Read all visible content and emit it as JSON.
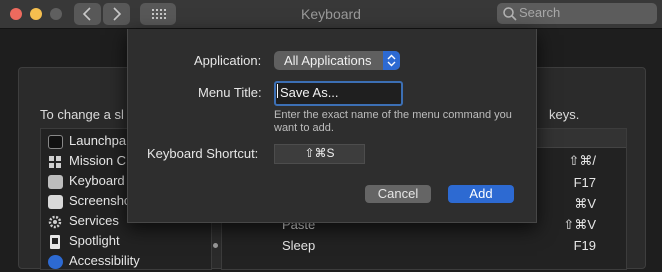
{
  "window": {
    "title": "Keyboard"
  },
  "search": {
    "placeholder": "Search"
  },
  "pane": {
    "instruction_left": "To change a sl",
    "instruction_right": "keys."
  },
  "sidebar": {
    "items": [
      {
        "label": "Launchpa",
        "icon": "launchpad-icon"
      },
      {
        "label": "Mission C",
        "icon": "mission-control-icon"
      },
      {
        "label": "Keyboard",
        "icon": "keyboard-icon"
      },
      {
        "label": "Screensho",
        "icon": "screenshot-icon"
      },
      {
        "label": "Services",
        "icon": "gear-icon"
      },
      {
        "label": "Spotlight",
        "icon": "spotlight-icon"
      },
      {
        "label": "Accessibility",
        "icon": "accessibility-icon"
      }
    ]
  },
  "shortcuts": {
    "rows": [
      {
        "name": "",
        "key": "⇧⌘/"
      },
      {
        "name": "",
        "key": "F17"
      },
      {
        "name": "",
        "key": "⌘V"
      },
      {
        "name": "Paste",
        "key": "⇧⌘V"
      },
      {
        "name": "Sleep",
        "key": "F19"
      }
    ]
  },
  "dialog": {
    "application_label": "Application:",
    "application_value": "All Applications",
    "menu_title_label": "Menu Title:",
    "menu_title_value": "Save As...",
    "help_text": "Enter the exact name of the menu command you want to add.",
    "shortcut_label": "Keyboard Shortcut:",
    "shortcut_value": "⇧⌘S",
    "cancel_label": "Cancel",
    "add_label": "Add"
  },
  "colors": {
    "accent": "#2d6ad2",
    "close": "#ed6a5e",
    "minimize": "#f5bf4f",
    "zoom": "#62c554"
  }
}
